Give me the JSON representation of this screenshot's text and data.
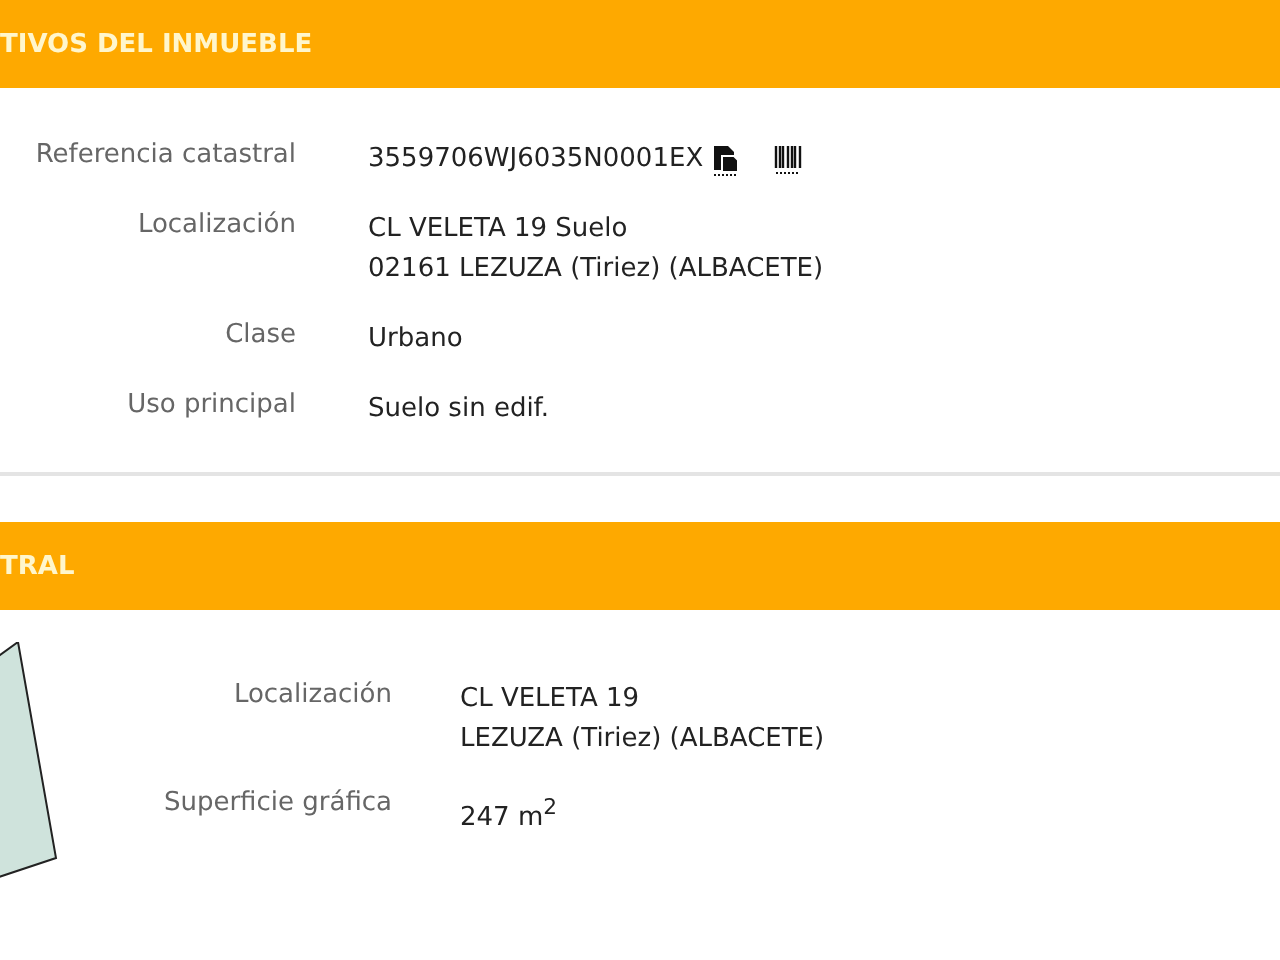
{
  "sections": [
    {
      "title": "TIVOS DEL INMUEBLE",
      "kind": "fields",
      "rows": [
        {
          "label": "Referencia catastral",
          "lines": [
            "3559706WJ6035N0001EX"
          ],
          "icons": true
        },
        {
          "label": "Localización",
          "lines": [
            "CL VELETA 19 Suelo",
            "02161 LEZUZA (Tiriez) (ALBACETE)"
          ]
        },
        {
          "label": "Clase",
          "lines": [
            "Urbano"
          ]
        },
        {
          "label": "Uso principal",
          "lines": [
            "Suelo sin edif."
          ]
        }
      ]
    },
    {
      "title": "TRAL",
      "kind": "map",
      "rows": [
        {
          "label": "Localización",
          "lines": [
            "CL VELETA 19",
            "LEZUZA (Tiriez) (ALBACETE)"
          ]
        },
        {
          "label": "Superficie gráfica",
          "lines": [
            "247 m$^{2}$"
          ]
        }
      ]
    }
  ]
}
